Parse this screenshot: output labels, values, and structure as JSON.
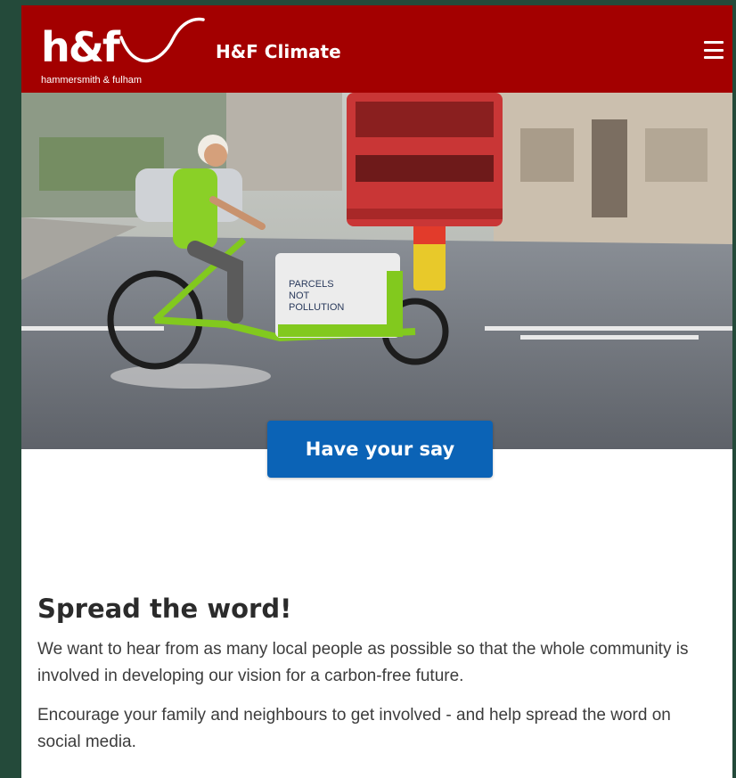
{
  "header": {
    "logo_mark": "h&f",
    "logo_subtitle": "hammersmith & fulham",
    "site_title": "H&F Climate",
    "menu_icon": "hamburger-menu-icon",
    "background_color": "#a30000"
  },
  "hero": {
    "box_text": [
      "PARCELS",
      "NOT",
      "POLLUTION"
    ],
    "cta_label": "Have your say",
    "cta_color": "#0b63b6"
  },
  "content": {
    "heading": "Spread the word!",
    "paragraphs": [
      "We want to hear from as many local people as possible so that the whole community is involved in developing our vision for a carbon-free future.",
      "Encourage your family and neighbours to get involved - and help spread the word on social media."
    ]
  }
}
